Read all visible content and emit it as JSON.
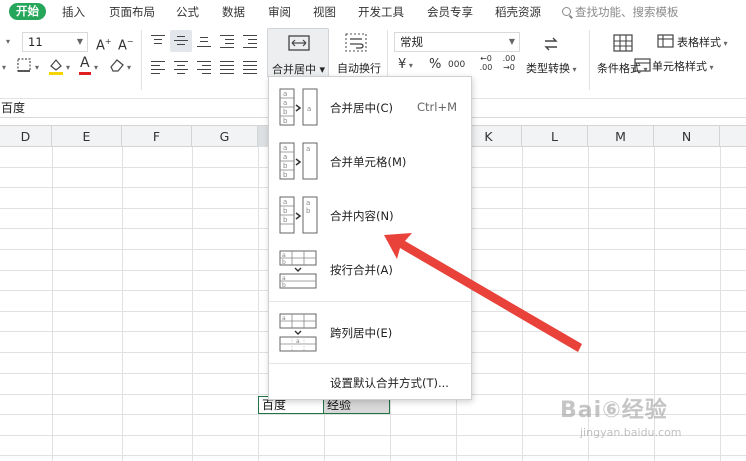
{
  "ribbon_tabs": [
    "开始",
    "插入",
    "页面布局",
    "公式",
    "数据",
    "审阅",
    "视图",
    "开发工具",
    "会员专享",
    "稻壳资源"
  ],
  "search_placeholder": "查找功能、搜索模板",
  "toolbar": {
    "font_size": "11",
    "increase_font": "A⁺",
    "decrease_font": "A⁻",
    "merge_center_label": "合并居中",
    "auto_wrap_label": "自动换行",
    "number_format": "常规",
    "currency_symbol": "¥",
    "percent_symbol": "%",
    "thousands_symbol": "000",
    "add_decimal": "←0 .00",
    "remove_decimal": ".00 →0",
    "type_convert_label": "类型转换",
    "conditional_format_label": "条件格式",
    "table_style_label": "表格样式",
    "cell_style_label": "单元格样式"
  },
  "formula_bar": {
    "content": "百度"
  },
  "columns": [
    "D",
    "E",
    "F",
    "G",
    "",
    "",
    "K",
    "L",
    "M",
    "N"
  ],
  "cells": {
    "cell1": "百度",
    "cell2": "经验"
  },
  "merge_menu": {
    "items": [
      {
        "label": "合并居中(C)",
        "shortcut": "Ctrl+M"
      },
      {
        "label": "合并单元格(M)",
        "shortcut": ""
      },
      {
        "label": "合并内容(N)",
        "shortcut": ""
      },
      {
        "label": "按行合并(A)",
        "shortcut": ""
      },
      {
        "label": "跨列居中(E)",
        "shortcut": ""
      },
      {
        "label": "设置默认合并方式(T)...",
        "shortcut": ""
      }
    ]
  },
  "watermark": {
    "main": "Bai⑥经验",
    "sub": "jingyan.baidu.com"
  },
  "colors": {
    "accent": "#26a65b",
    "arrow": "#e8423a",
    "selection_border": "#217346"
  }
}
